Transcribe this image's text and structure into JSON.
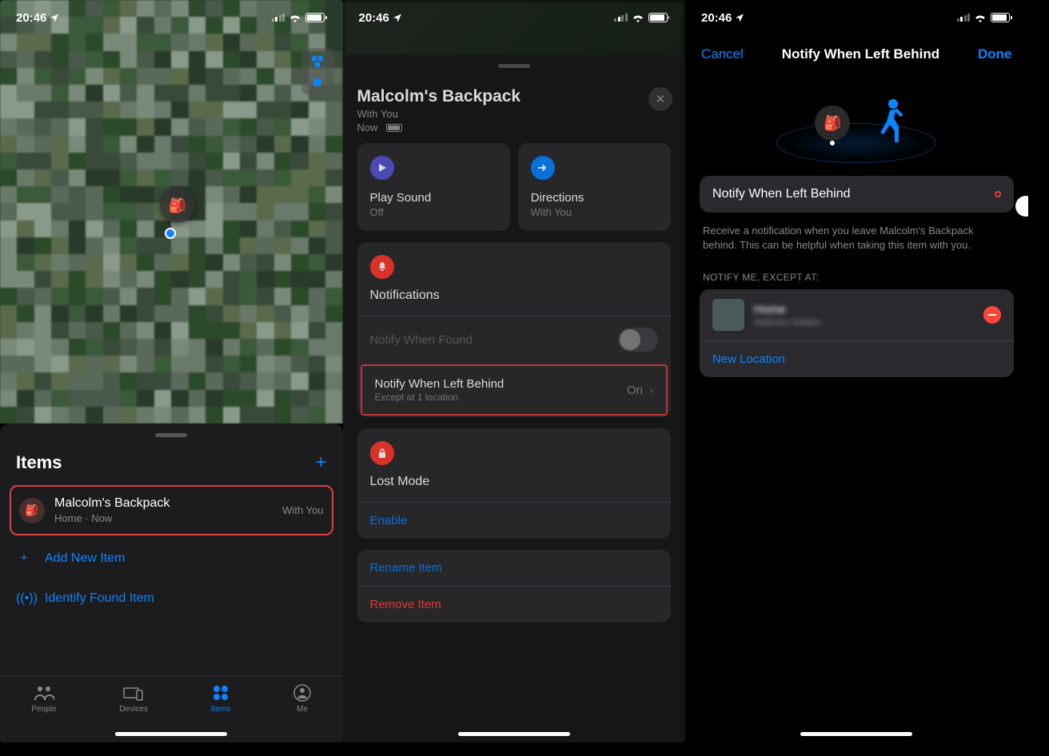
{
  "status": {
    "time": "20:46"
  },
  "phone1": {
    "items_title": "Items",
    "item": {
      "name": "Malcolm's Backpack",
      "sub": "Home · Now",
      "status": "With You"
    },
    "add_item": "Add New Item",
    "identify": "Identify Found Item",
    "tabs": {
      "people": "People",
      "devices": "Devices",
      "items": "Items",
      "me": "Me"
    }
  },
  "phone2": {
    "title": "Malcolm's Backpack",
    "sub1": "With You",
    "sub2": "Now",
    "play_sound": {
      "title": "Play Sound",
      "sub": "Off"
    },
    "directions": {
      "title": "Directions",
      "sub": "With You"
    },
    "notifications": "Notifications",
    "notify_found": "Notify When Found",
    "notify_left": {
      "title": "Notify When Left Behind",
      "sub": "Except at 1 location",
      "value": "On"
    },
    "lost_mode": "Lost Mode",
    "enable": "Enable",
    "rename": "Rename Item",
    "remove": "Remove Item"
  },
  "phone3": {
    "cancel": "Cancel",
    "title": "Notify When Left Behind",
    "done": "Done",
    "toggle_label": "Notify When Left Behind",
    "help": "Receive a notification when you leave Malcolm's Backpack behind. This can be helpful when taking this item with you.",
    "except_header": "NOTIFY ME, EXCEPT AT:",
    "location": {
      "name": "Home",
      "addr": "Address hidden"
    },
    "new_location": "New Location"
  }
}
